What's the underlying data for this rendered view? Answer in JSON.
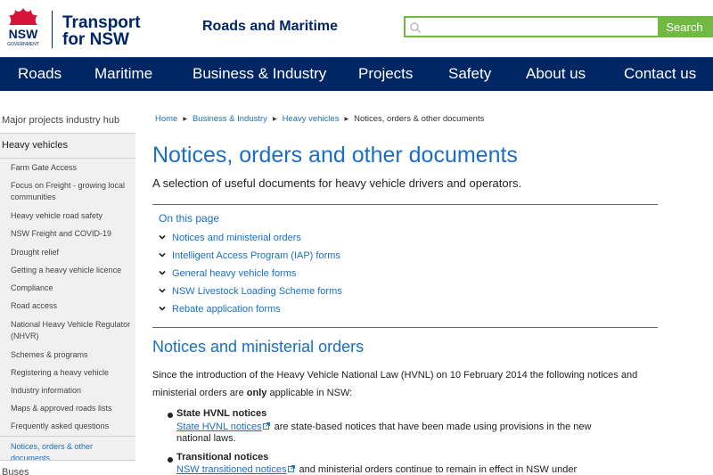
{
  "header": {
    "logo_text": "NSW",
    "logo_sub": "GOVERNMENT",
    "brand_line1": "Transport",
    "brand_line2": "for NSW",
    "agency": "Roads and Maritime",
    "search_placeholder": "",
    "search_button": "Search",
    "accent_color": "#71b943",
    "navy_color": "#002664"
  },
  "nav": {
    "items": [
      "Roads",
      "Maritime",
      "Business & Industry",
      "Projects",
      "Safety",
      "About us",
      "Contact us"
    ]
  },
  "sidebar": {
    "top_link": "Major projects industry hub",
    "heading": "Heavy vehicles",
    "items": [
      "Farm Gate Access",
      "Focus on Freight - growing local communities",
      "Heavy vehicle road safety",
      "NSW Freight and COVID-19",
      "Drought relief",
      "Getting a heavy vehicle licence",
      "Compliance",
      "Road access",
      "National Heavy Vehicle Regulator (NHVR)",
      "Schemes & programs",
      "Registering a heavy vehicle",
      "Industry information",
      "Maps & approved roads lists",
      "Frequently asked questions",
      "Notices, orders & other documents"
    ],
    "bottom_link": "Buses"
  },
  "breadcrumb": {
    "items": [
      "Home",
      "Business & Industry",
      "Heavy vehicles"
    ],
    "current": "Notices, orders & other documents"
  },
  "main": {
    "title": "Notices, orders and other documents",
    "intro": "A selection of useful documents for heavy vehicle drivers and operators.",
    "on_this_page": {
      "heading": "On this page",
      "items": [
        "Notices and ministerial orders",
        "Intelligent Access Program (IAP) forms",
        "General heavy vehicle forms",
        "NSW Livestock Loading Scheme forms",
        "Rebate application forms"
      ]
    },
    "section_title": "Notices and ministerial orders",
    "body_before": "Since the introduction of the Heavy Vehicle National Law (HVNL) on 10 February 2014 the following notices and ministerial orders are ",
    "body_bold": "only",
    "body_after": " applicable in NSW:",
    "list": [
      {
        "title": "State HVNL notices",
        "link": "State HVNL notices",
        "text": "are state-based notices that have been made using provisions in the new national laws."
      },
      {
        "title": "Transitional notices",
        "link": "NSW transitioned notices",
        "text": "and ministerial orders continue to remain in effect in NSW under"
      }
    ]
  }
}
